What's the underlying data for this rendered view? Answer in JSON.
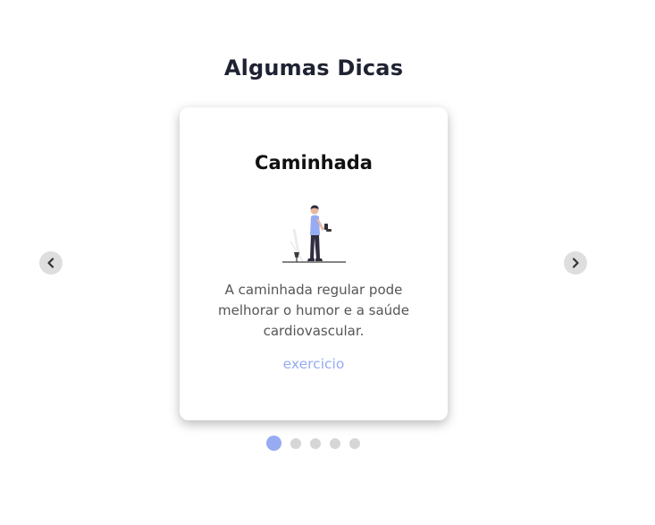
{
  "section": {
    "title": "Algumas Dicas"
  },
  "card": {
    "title": "Caminhada",
    "description": "A caminhada regular pode melhorar o humor e a saúde cardiovascular.",
    "tag": "exercicio",
    "illustration": "person-walking-illustration"
  },
  "navigation": {
    "prev_icon": "chevron-left-icon",
    "next_icon": "chevron-right-icon"
  },
  "pagination": {
    "count": 5,
    "active_index": 0
  },
  "colors": {
    "heading": "#1f2233",
    "accent": "#96abf2",
    "active_dot": "#96abf2",
    "inactive_dot": "#d6d6d6",
    "nav_button_bg": "#dedede"
  }
}
